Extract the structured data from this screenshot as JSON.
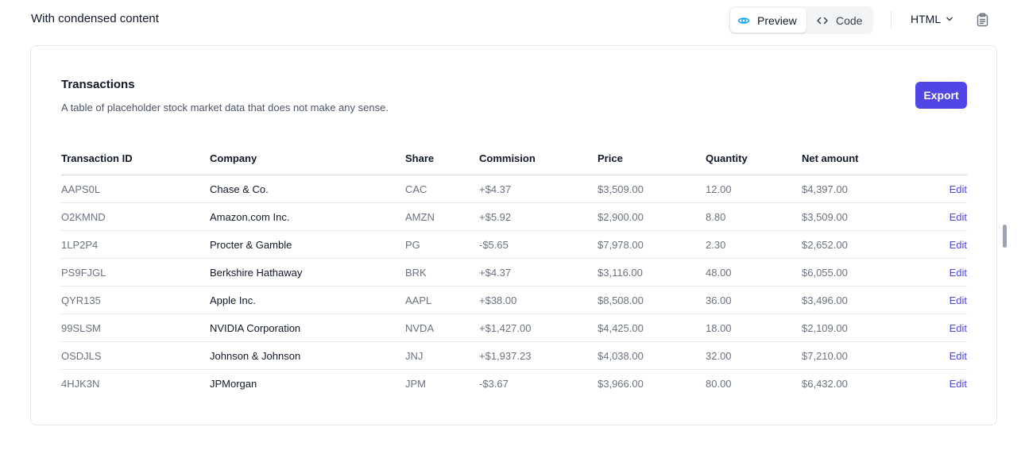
{
  "header": {
    "title": "With condensed content",
    "preview_label": "Preview",
    "code_label": "Code",
    "language": "HTML",
    "icons": {
      "preview": "eye-icon",
      "code": "code-brackets-icon",
      "language": "chevron-down-icon",
      "copy": "clipboard-icon"
    }
  },
  "card": {
    "title": "Transactions",
    "description": "A table of placeholder stock market data that does not make any sense.",
    "export_label": "Export"
  },
  "table": {
    "columns": [
      "Transaction ID",
      "Company",
      "Share",
      "Commision",
      "Price",
      "Quantity",
      "Net amount"
    ],
    "edit_label": "Edit",
    "rows": [
      {
        "id": "AAPS0L",
        "company": "Chase & Co.",
        "share": "CAC",
        "commission": "+$4.37",
        "price": "$3,509.00",
        "quantity": "12.00",
        "net": "$4,397.00"
      },
      {
        "id": "O2KMND",
        "company": "Amazon.com Inc.",
        "share": "AMZN",
        "commission": "+$5.92",
        "price": "$2,900.00",
        "quantity": "8.80",
        "net": "$3,509.00"
      },
      {
        "id": "1LP2P4",
        "company": "Procter & Gamble",
        "share": "PG",
        "commission": "-$5.65",
        "price": "$7,978.00",
        "quantity": "2.30",
        "net": "$2,652.00"
      },
      {
        "id": "PS9FJGL",
        "company": "Berkshire Hathaway",
        "share": "BRK",
        "commission": "+$4.37",
        "price": "$3,116.00",
        "quantity": "48.00",
        "net": "$6,055.00"
      },
      {
        "id": "QYR135",
        "company": "Apple Inc.",
        "share": "AAPL",
        "commission": "+$38.00",
        "price": "$8,508.00",
        "quantity": "36.00",
        "net": "$3,496.00"
      },
      {
        "id": "99SLSM",
        "company": "NVIDIA Corporation",
        "share": "NVDA",
        "commission": "+$1,427.00",
        "price": "$4,425.00",
        "quantity": "18.00",
        "net": "$2,109.00"
      },
      {
        "id": "OSDJLS",
        "company": "Johnson & Johnson",
        "share": "JNJ",
        "commission": "+$1,937.23",
        "price": "$4,038.00",
        "quantity": "32.00",
        "net": "$7,210.00"
      },
      {
        "id": "4HJK3N",
        "company": "JPMorgan",
        "share": "JPM",
        "commission": "-$3.67",
        "price": "$3,966.00",
        "quantity": "80.00",
        "net": "$6,432.00"
      }
    ]
  },
  "colors": {
    "accent": "#4f46e5",
    "border": "#e5e7eb",
    "muted_text": "#6b7280"
  }
}
